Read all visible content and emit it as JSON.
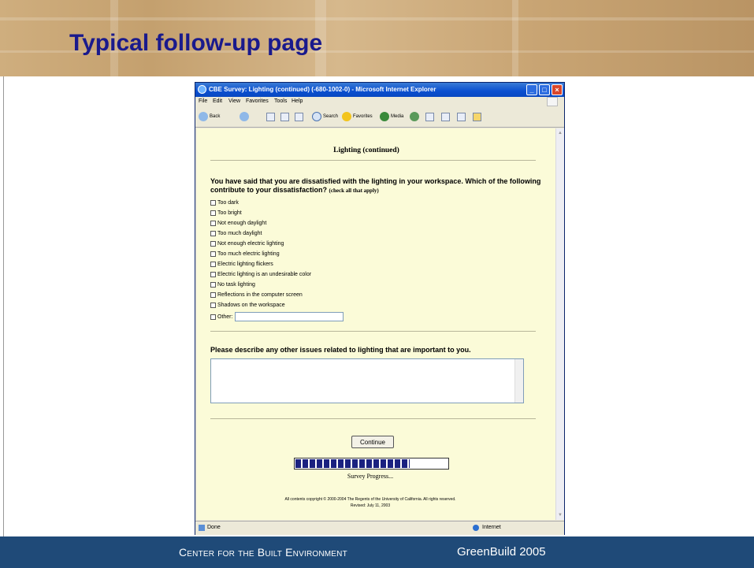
{
  "slide": {
    "title": "Typical follow-up page",
    "footer_left": "Center for the Built Environment",
    "footer_right": "GreenBuild 2005"
  },
  "window": {
    "title": "CBE Survey: Lighting (continued) (-680-1002-0) - Microsoft Internet Explorer",
    "minimize": "_",
    "maximize": "□",
    "close": "×"
  },
  "menu": [
    "File",
    "Edit",
    "View",
    "Favorites",
    "Tools",
    "Help"
  ],
  "toolbar": {
    "back": "Back",
    "search": "Search",
    "favorites": "Favorites",
    "media": "Media"
  },
  "page": {
    "heading": "Lighting (continued)",
    "question1": "You have said that you are dissatisfied with the lighting in your workspace. Which of the following contribute to your dissatisfaction?",
    "question1_hint": "(check all that apply)",
    "options": [
      "Too dark",
      "Too bright",
      "Not enough daylight",
      "Too much daylight",
      "Not enough electric lighting",
      "Too much electric lighting",
      "Electric lighting flickers",
      "Electric lighting is an undesirable color",
      "No task lighting",
      "Reflections in the computer screen",
      "Shadows on the workspace"
    ],
    "other_label": "Other:",
    "other_value": "",
    "question2": "Please describe any other issues related to lighting that are important to you.",
    "comments_value": "",
    "continue_label": "Continue",
    "progress": 0.75,
    "progress_label": "Survey Progress...",
    "copyright_line1": "All contents copyright © 2000-2004 The Regents of the University of California. All rights reserved.",
    "copyright_line2": "Revised: July 11, 2003"
  },
  "status": {
    "left": "Done",
    "right": "Internet"
  }
}
